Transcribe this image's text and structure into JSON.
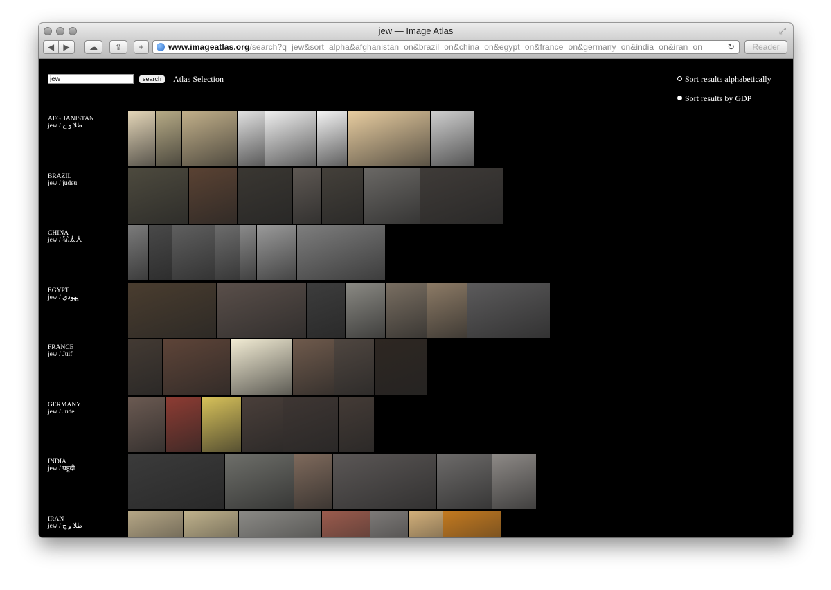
{
  "window": {
    "title": "jew — Image Atlas"
  },
  "toolbar": {
    "back_icon": "◀",
    "forward_icon": "▶",
    "cloud_icon": "☁",
    "share_icon": "⇪",
    "add_icon": "+",
    "url_host": "www.imageatlas.org",
    "url_rest": "/search?q=jew&sort=alpha&afghanistan=on&brazil=on&china=on&egypt=on&france=on&germany=on&india=on&iran=on",
    "reload_icon": "↻",
    "reader_label": "Reader"
  },
  "search": {
    "value": "jew",
    "button_label": "search",
    "atlas_selection": "Atlas Selection"
  },
  "sort": {
    "alpha_label": "Sort results alphabetically",
    "gdp_label": "Sort results by GDP",
    "selected": "alpha"
  },
  "rows": [
    {
      "country": "AFGHANISTAN",
      "terms": "jew / ﻃﻼ و ﺝ",
      "tiles": [
        "#e4d6b8",
        "#b7ab86",
        "#c2b08a",
        "#e2e2e2",
        "#efefef",
        "#f4f4f4",
        "#e8cda0",
        "#cfcfcf"
      ]
    },
    {
      "country": "BRAZIL",
      "terms": "jew / judeu",
      "tiles": [
        "#4d4a3e",
        "#5a4233",
        "#3a3732",
        "#5e5853",
        "#44403a",
        "#6a6865",
        "#3f3b38"
      ]
    },
    {
      "country": "CHINA",
      "terms": "jew / 犹太人",
      "tiles": [
        "#7b7b7b",
        "#494949",
        "#5f5f5f",
        "#6c6c6c",
        "#8a8a8a",
        "#9a9a9a",
        "#7e7e7e"
      ]
    },
    {
      "country": "EGYPT",
      "terms": "jew / يهودي",
      "tiles": [
        "#4a3d2f",
        "#5a4f4a",
        "#3d3d3d",
        "#8b8a84",
        "#7a6f62",
        "#8d7b66",
        "#5c5b5c"
      ]
    },
    {
      "country": "FRANCE",
      "terms": "jew / Juif",
      "tiles": [
        "#433a33",
        "#5e4438",
        "#f2ecd4",
        "#6f5a4c",
        "#4f4640",
        "#2e2722"
      ]
    },
    {
      "country": "GERMANY",
      "terms": "jew / Jude",
      "tiles": [
        "#6b5a52",
        "#8e3c33",
        "#d8c25a",
        "#4a3f3a",
        "#3e3633",
        "#443b36"
      ]
    },
    {
      "country": "INDIA",
      "terms": "jew / यहूदी",
      "tiles": [
        "#3b3b3b",
        "#6e6f6a",
        "#7f6a5c",
        "#5b5756",
        "#6d6b6a",
        "#8e8a87"
      ]
    },
    {
      "country": "IRAN",
      "terms": "jew / ﻃﻼ و ﺝ",
      "tiles": [
        "#b6a786",
        "#c0b28c",
        "#8b8a86",
        "#9b5b4d",
        "#7d7a78",
        "#d3b07a",
        "#c47a1f"
      ]
    }
  ]
}
